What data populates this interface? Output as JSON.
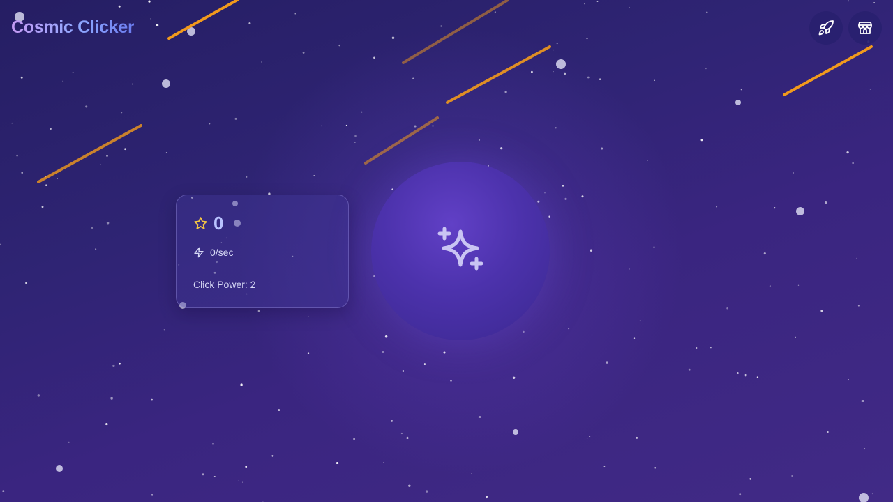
{
  "app": {
    "title": "Cosmic Clicker"
  },
  "header": {
    "buttons": [
      {
        "icon": "rocket-icon"
      },
      {
        "icon": "store-icon"
      }
    ]
  },
  "stats": {
    "score": "0",
    "score_icon": "star-icon",
    "rate": "0/sec",
    "rate_icon": "lightning-icon",
    "click_power": "Click Power: 2"
  },
  "orb": {
    "icon": "sparkles-icon"
  },
  "colors": {
    "background": "#2f2474",
    "title_gradient_start": "#c59bf4",
    "title_gradient_end": "#6b7cf0",
    "star_icon": "#f5c542",
    "score_text": "#b9c3ff",
    "orb": "#4c32ac",
    "shooting_star": "#f29a1c"
  }
}
